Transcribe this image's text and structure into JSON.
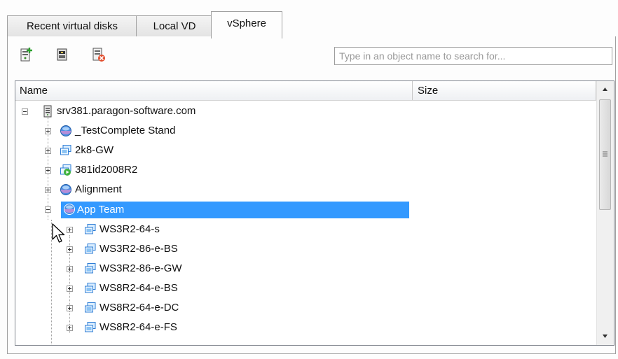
{
  "tabs": [
    {
      "label": "Recent virtual disks",
      "active": false
    },
    {
      "label": "Local VD",
      "active": false
    },
    {
      "label": "vSphere",
      "active": true
    }
  ],
  "toolbar": {
    "buttons": [
      {
        "icon": "new-disk-icon"
      },
      {
        "icon": "disk-properties-icon"
      },
      {
        "icon": "remove-disk-icon"
      }
    ],
    "search_placeholder": "Type in an object name to search for..."
  },
  "columns": {
    "name": "Name",
    "size": "Size"
  },
  "tree": {
    "root": {
      "label": "srv381.paragon-software.com",
      "icon": "server-icon",
      "expanded": true
    },
    "items": [
      {
        "label": "_TestComplete Stand",
        "icon": "resource-pool-icon",
        "expanded": false,
        "selected": false
      },
      {
        "label": "2k8-GW",
        "icon": "virtual-machine-icon",
        "expanded": false,
        "selected": false
      },
      {
        "label": "381id2008R2",
        "icon": "vm-running-icon",
        "expanded": false,
        "selected": false
      },
      {
        "label": "Alignment",
        "icon": "resource-pool-icon",
        "expanded": false,
        "selected": false
      },
      {
        "label": "App Team",
        "icon": "resource-pool-icon",
        "expanded": true,
        "selected": true
      }
    ],
    "children": [
      {
        "label": "WS3R2-64-s",
        "icon": "virtual-machine-icon"
      },
      {
        "label": "WS3R2-86-e-BS",
        "icon": "virtual-machine-icon"
      },
      {
        "label": "WS3R2-86-e-GW",
        "icon": "virtual-machine-icon"
      },
      {
        "label": "WS8R2-64-e-BS",
        "icon": "virtual-machine-icon"
      },
      {
        "label": "WS8R2-64-e-DC",
        "icon": "virtual-machine-icon"
      },
      {
        "label": "WS8R2-64-e-FS",
        "icon": "virtual-machine-icon"
      }
    ]
  },
  "colors": {
    "selection": "#3399ff",
    "accent": "#3b78d8"
  }
}
